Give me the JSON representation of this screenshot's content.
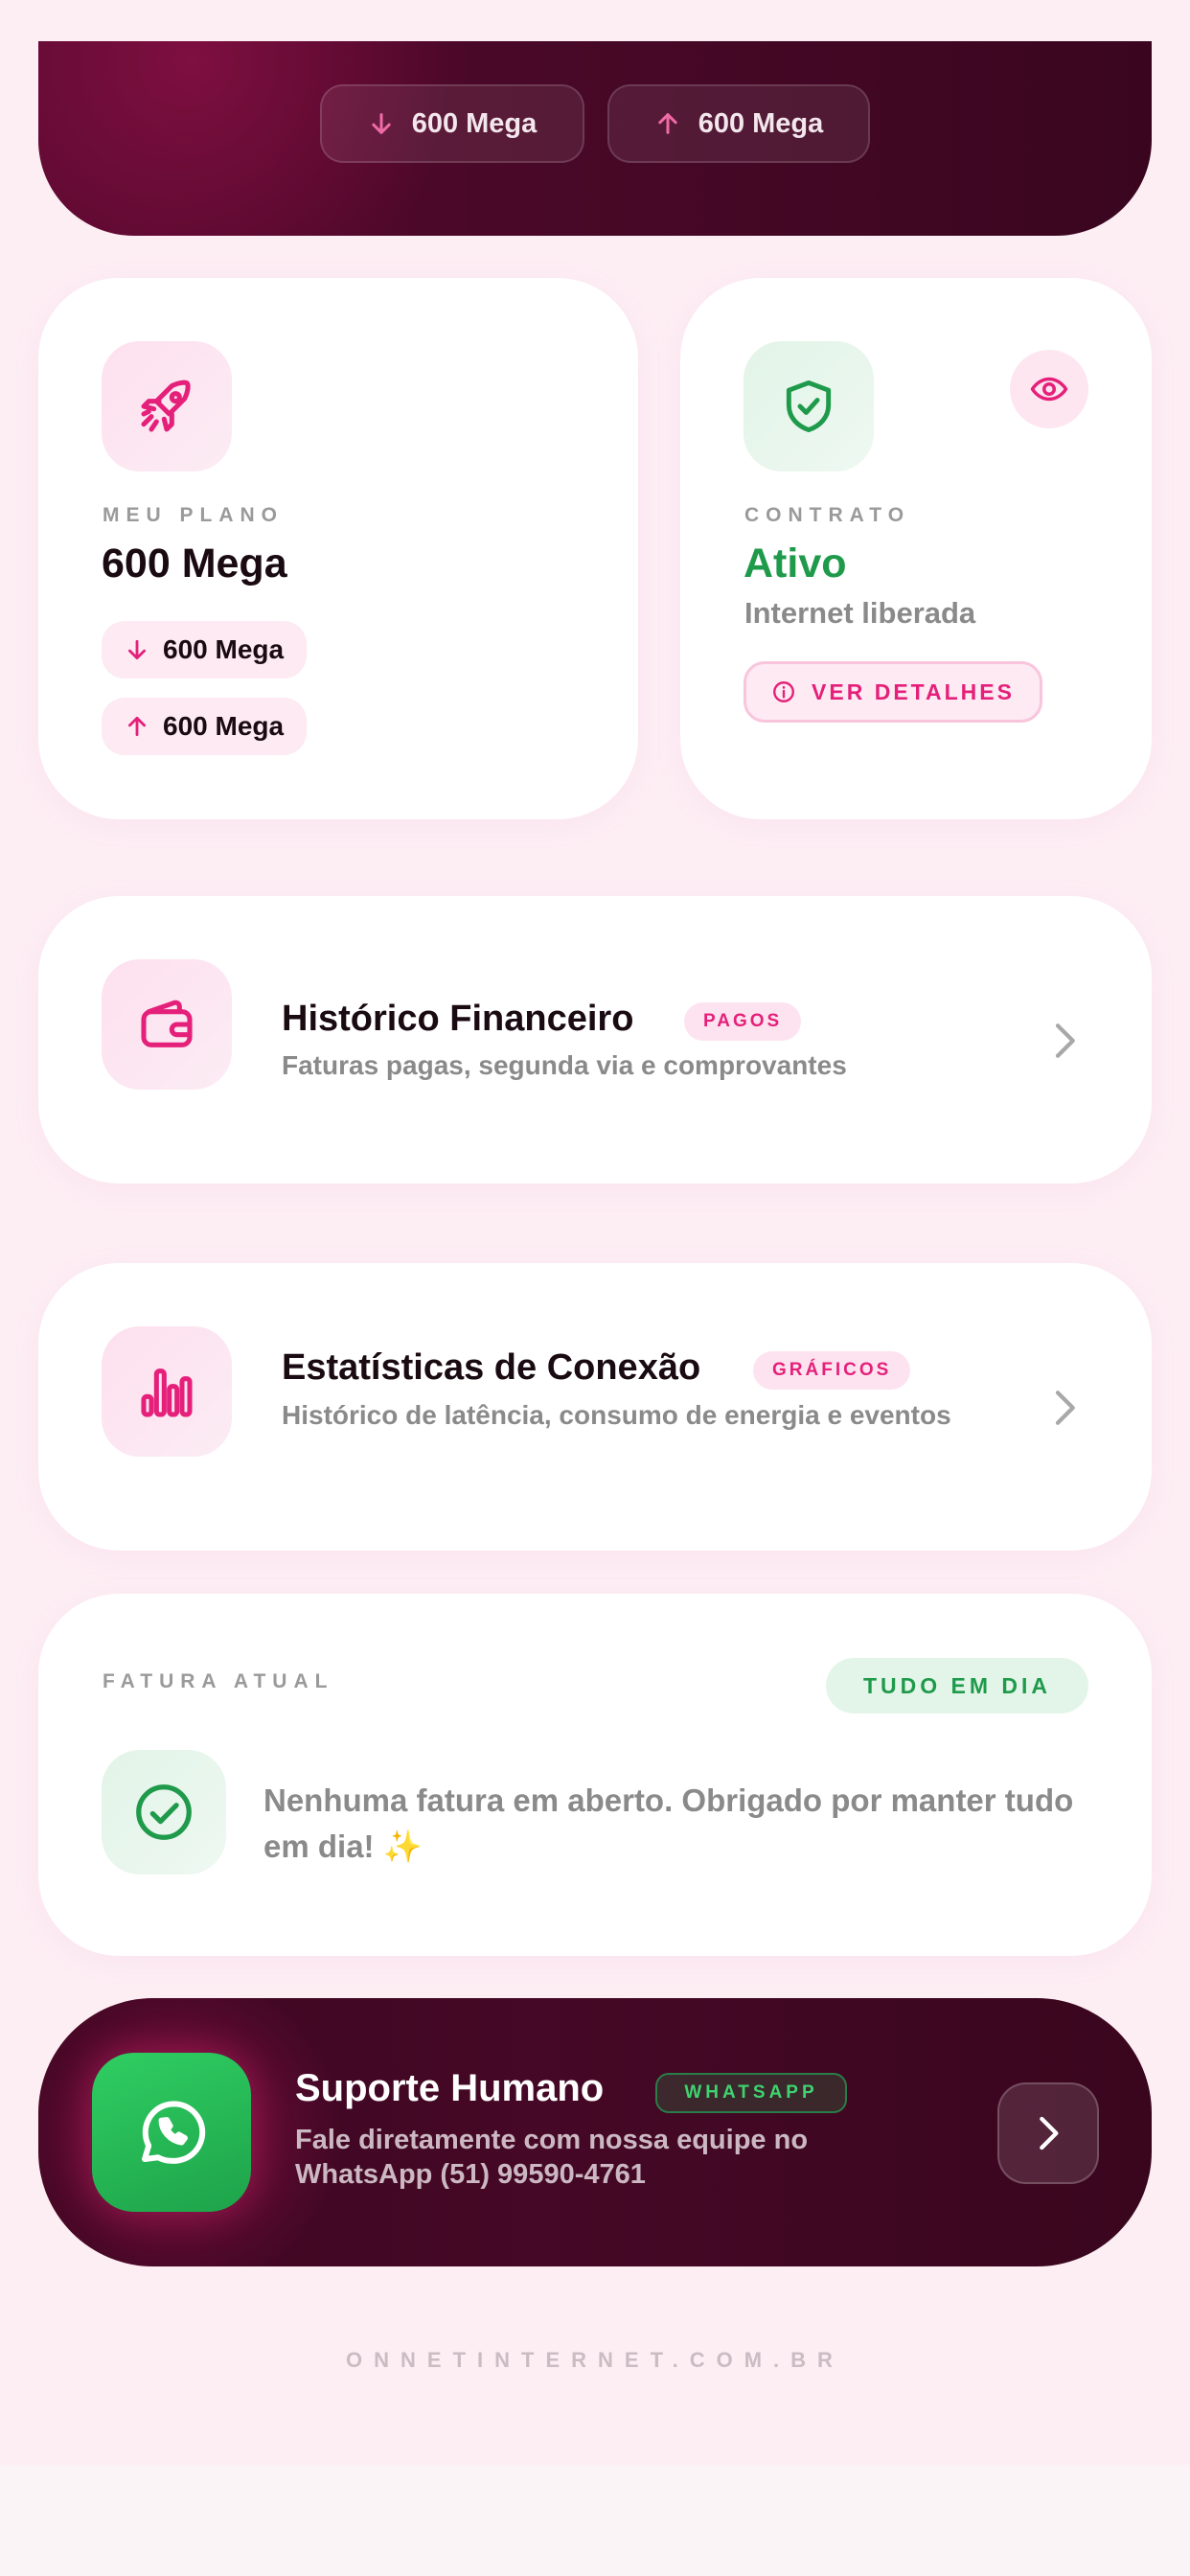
{
  "hero": {
    "download_label": "600 Mega",
    "upload_label": "600 Mega"
  },
  "plan": {
    "overline": "MEU PLANO",
    "title": "600 Mega",
    "download": "600 Mega",
    "upload": "600 Mega",
    "icon": "rocket-icon"
  },
  "contract": {
    "overline": "CONTRATO",
    "status": "Ativo",
    "subtitle": "Internet liberada",
    "details_label": "VER DETALHES",
    "icon": "shield-check-icon"
  },
  "finance": {
    "title": "Histórico Financeiro",
    "badge": "PAGOS",
    "subtitle": "Faturas pagas, segunda via e comprovantes",
    "icon": "wallet-icon"
  },
  "stats": {
    "title": "Estatísticas de Conexão",
    "badge": "GRÁFICOS",
    "subtitle": "Histórico de latência, consumo de energia e eventos",
    "icon": "bar-chart-icon"
  },
  "invoice": {
    "overline": "FATURA ATUAL",
    "status": "TUDO EM DIA",
    "message": "Nenhuma fatura em aberto. Obrigado por manter tudo em dia! ✨",
    "icon": "check-circle-icon"
  },
  "support": {
    "title": "Suporte Humano",
    "badge": "WHATSAPP",
    "subtitle": "Fale diretamente com nossa equipe no WhatsApp (51) 99590-4761",
    "icon": "whatsapp-icon"
  },
  "footer": {
    "domain": "ONNETINTERNET.COM.BR"
  },
  "colors": {
    "accent": "#e5207a",
    "success": "#1f9a4b",
    "hero_bg": "#4a0828",
    "background": "#fdeef4"
  }
}
